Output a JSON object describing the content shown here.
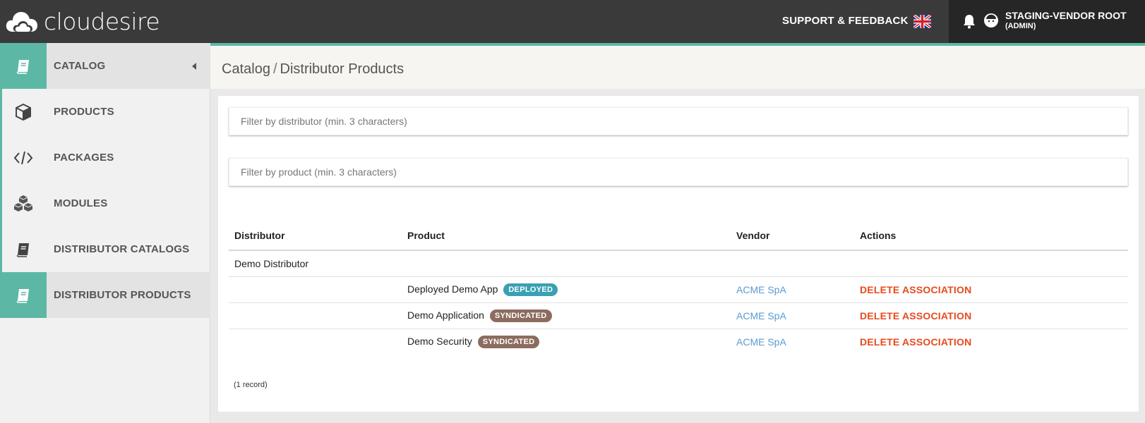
{
  "app": {
    "logo_text": "cloudesire"
  },
  "topbar": {
    "support_label": "SUPPORT & FEEDBACK",
    "flag_icon": "uk-flag-icon",
    "user_name": "STAGING-VENDOR ROOT",
    "user_role": "(ADMIN)"
  },
  "sidebar": {
    "items": [
      {
        "label": "CATALOG",
        "icon": "book-icon",
        "active": true
      },
      {
        "label": "PRODUCTS",
        "icon": "box-icon"
      },
      {
        "label": "PACKAGES",
        "icon": "code-icon"
      },
      {
        "label": "MODULES",
        "icon": "cubes-icon"
      },
      {
        "label": "DISTRIBUTOR CATALOGS",
        "icon": "book-icon"
      },
      {
        "label": "DISTRIBUTOR PRODUCTS",
        "icon": "book-icon",
        "active": true
      }
    ]
  },
  "breadcrumb": {
    "root": "Catalog",
    "separator": "/",
    "current": "Distributor Products"
  },
  "filters": {
    "distributor_placeholder": "Filter by distributor (min. 3 characters)",
    "distributor_value": "",
    "product_placeholder": "Filter by product (min. 3 characters)",
    "product_value": ""
  },
  "table": {
    "headers": [
      "Distributor",
      "Product",
      "Vendor",
      "Actions"
    ],
    "group": {
      "distributor": "Demo Distributor"
    },
    "rows": [
      {
        "product": "Deployed Demo App",
        "badge": "DEPLOYED",
        "vendor": "ACME SpA",
        "action": "DELETE ASSOCIATION"
      },
      {
        "product": "Demo Application",
        "badge": "SYNDICATED",
        "vendor": "ACME SpA",
        "action": "DELETE ASSOCIATION"
      },
      {
        "product": "Demo Security",
        "badge": "SYNDICATED",
        "vendor": "ACME SpA",
        "action": "DELETE ASSOCIATION"
      }
    ]
  },
  "footer": {
    "record_count": "(1 record)"
  },
  "colors": {
    "accent": "#5cb8a5",
    "topbar": "#3a3a3a",
    "deployed": "#3aa0b3",
    "syndicated": "#8c6c5f",
    "danger": "#e84a1d",
    "link": "#5b9bd1"
  }
}
